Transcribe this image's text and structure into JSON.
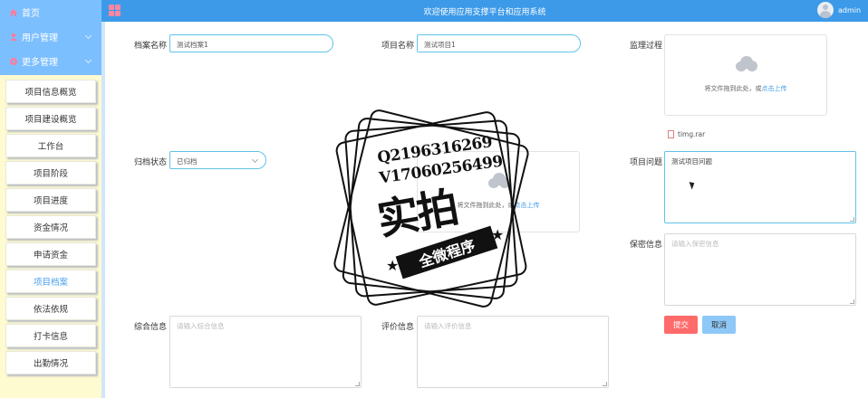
{
  "header": {
    "title": "欢迎使用应用支撑平台和应用系统",
    "username": "admin"
  },
  "sidebar": {
    "top_nav": [
      {
        "label": "首页",
        "icon": "home-icon"
      },
      {
        "label": "用户管理",
        "icon": "user-icon"
      },
      {
        "label": "更多管理",
        "icon": "more-icon"
      }
    ],
    "items": [
      {
        "label": "项目信息概览"
      },
      {
        "label": "项目建设概览"
      },
      {
        "label": "工作台"
      },
      {
        "label": "项目阶段"
      },
      {
        "label": "项目进度"
      },
      {
        "label": "资金情况"
      },
      {
        "label": "申请资金"
      },
      {
        "label": "项目档案",
        "active": true
      },
      {
        "label": "依法依规"
      },
      {
        "label": "打卡信息"
      },
      {
        "label": "出勤情况"
      }
    ]
  },
  "form": {
    "archive_name": {
      "label": "档案名称",
      "value": "测试档案1"
    },
    "project_name": {
      "label": "项目名称",
      "value": "测试项目1"
    },
    "supervision": {
      "label": "监理过程",
      "upload_hint": "将文件拖到此处，或",
      "upload_link": "点击上传",
      "file": "timg.rar"
    },
    "archive_status": {
      "label": "归档状态",
      "value": "已归档"
    },
    "middle_upload": {
      "hint": "将文件拖到此处，或",
      "link": "点击上传"
    },
    "project_issue": {
      "label": "项目问题",
      "value": "测试项目问题"
    },
    "confidential": {
      "label": "保密信息",
      "placeholder": "请输入保密信息"
    },
    "comprehensive": {
      "label": "综合信息",
      "placeholder": "请输入综合信息"
    },
    "evaluation": {
      "label": "评价信息",
      "placeholder": "请输入评价信息"
    },
    "submit_label": "提交",
    "cancel_label": "取消"
  },
  "watermark": {
    "line1": "Q2196316269",
    "line2": "V17060256499",
    "big": "实拍",
    "ribbon": "全微程序"
  },
  "colors": {
    "header": "#3c9ae8",
    "sidebar_top": "#7cbfff",
    "sidebar_bg": "#fffbd0",
    "active_text": "#4aa0ee",
    "submit": "#ff6a6a",
    "cancel": "#8ec8f8"
  }
}
